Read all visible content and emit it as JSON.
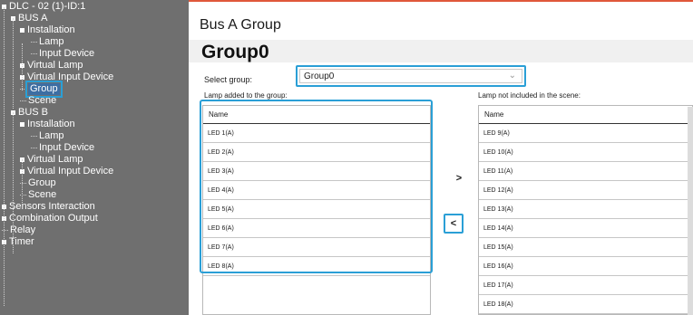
{
  "sidebar": {
    "items": [
      {
        "label": "DLC - 02 (1)-ID:1",
        "level": 0,
        "expander": true,
        "selected": false
      },
      {
        "label": "BUS A",
        "level": 1,
        "expander": true,
        "selected": false
      },
      {
        "label": "Installation",
        "level": 2,
        "expander": true,
        "selected": false
      },
      {
        "label": "Lamp",
        "level": 3,
        "expander": false,
        "selected": false
      },
      {
        "label": "Input Device",
        "level": 3,
        "expander": false,
        "selected": false
      },
      {
        "label": "Virtual Lamp",
        "level": 2,
        "expander": true,
        "selected": false
      },
      {
        "label": "Virtual Input Device",
        "level": 2,
        "expander": true,
        "selected": false
      },
      {
        "label": "Group",
        "level": 2,
        "expander": false,
        "selected": true
      },
      {
        "label": "Scene",
        "level": 2,
        "expander": false,
        "selected": false
      },
      {
        "label": "BUS B",
        "level": 1,
        "expander": true,
        "selected": false
      },
      {
        "label": "Installation",
        "level": 2,
        "expander": true,
        "selected": false
      },
      {
        "label": "Lamp",
        "level": 3,
        "expander": false,
        "selected": false
      },
      {
        "label": "Input Device",
        "level": 3,
        "expander": false,
        "selected": false
      },
      {
        "label": "Virtual Lamp",
        "level": 2,
        "expander": true,
        "selected": false
      },
      {
        "label": "Virtual Input Device",
        "level": 2,
        "expander": true,
        "selected": false
      },
      {
        "label": "Group",
        "level": 2,
        "expander": false,
        "selected": false
      },
      {
        "label": "Scene",
        "level": 2,
        "expander": false,
        "selected": false
      },
      {
        "label": "Sensors Interaction",
        "level": 0,
        "expander": true,
        "selected": false
      },
      {
        "label": "Combination Output",
        "level": 0,
        "expander": true,
        "selected": false
      },
      {
        "label": "Relay",
        "level": 0,
        "expander": false,
        "selected": false
      },
      {
        "label": "Timer",
        "level": 0,
        "expander": true,
        "selected": false
      }
    ]
  },
  "main": {
    "title": "Bus A Group",
    "group_heading": "Group0",
    "select_label": "Select group:",
    "select_value": "Group0",
    "select_icon": "chevron-down-icon",
    "added_caption": "Lamp added to the group:",
    "not_included_caption": "Lamp not included in the scene:",
    "added_list": {
      "header": "Name",
      "rows": [
        "LED 1(A)",
        "LED 2(A)",
        "LED 3(A)",
        "LED 4(A)",
        "LED 5(A)",
        "LED 6(A)",
        "LED 7(A)",
        "LED 8(A)"
      ]
    },
    "not_included_list": {
      "header": "Name",
      "rows": [
        "LED 9(A)",
        "LED 10(A)",
        "LED 11(A)",
        "LED 12(A)",
        "LED 13(A)",
        "LED 14(A)",
        "LED 15(A)",
        "LED 16(A)",
        "LED 17(A)",
        "LED 18(A)"
      ]
    },
    "move_right_label": ">",
    "move_left_label": "<"
  },
  "colors": {
    "sidebar_bg": "#6f6f6f",
    "highlight": "#2a9fd6",
    "accent": "#e0583a"
  }
}
